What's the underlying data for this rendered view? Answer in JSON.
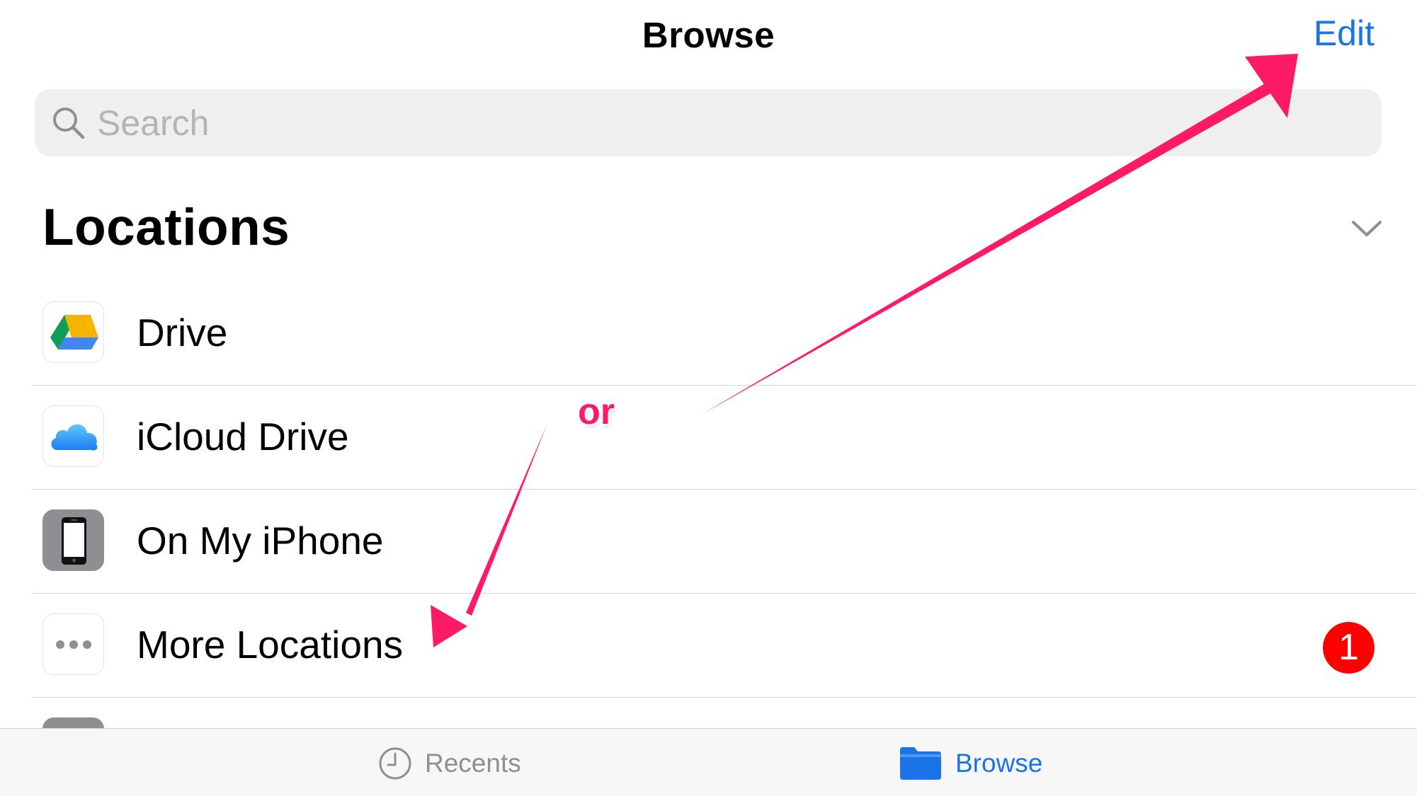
{
  "nav": {
    "title": "Browse",
    "edit_label": "Edit"
  },
  "search": {
    "placeholder": "Search",
    "value": ""
  },
  "locations": {
    "title": "Locations",
    "items": [
      {
        "label": "Drive",
        "icon": "google-drive-icon"
      },
      {
        "label": "iCloud Drive",
        "icon": "icloud-icon"
      },
      {
        "label": "On My iPhone",
        "icon": "iphone-icon"
      },
      {
        "label": "More Locations",
        "icon": "more-dots-icon",
        "badge": "1"
      }
    ]
  },
  "tabs": [
    {
      "label": "Recents",
      "icon": "clock-icon",
      "selected": false
    },
    {
      "label": "Browse",
      "icon": "folder-icon",
      "selected": true
    }
  ],
  "annotation": {
    "or_label": "or",
    "color": "#ff1a66"
  },
  "colors": {
    "accent": "#1a73e8",
    "badge": "#ff0000",
    "annotation": "#ff1a66"
  }
}
